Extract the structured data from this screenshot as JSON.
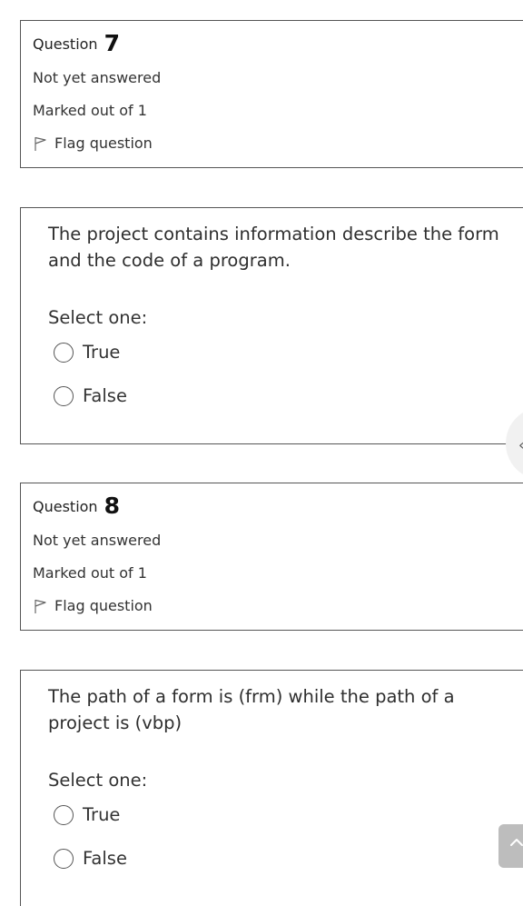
{
  "questions": [
    {
      "label": "Question",
      "number": "7",
      "state": "Not yet answered",
      "grade": "Marked out of 1",
      "flag_label": "Flag question",
      "text": "The project contains information describe the form and the code of a program.",
      "prompt": "Select one:",
      "options": [
        "True",
        "False"
      ]
    },
    {
      "label": "Question",
      "number": "8",
      "state": "Not yet answered",
      "grade": "Marked out of 1",
      "flag_label": "Flag question",
      "text": "The path of a form is (frm) while the path of a project is (vbp)",
      "prompt": "Select one:",
      "options": [
        "True",
        "False"
      ]
    }
  ],
  "icons": {
    "flag": "flag-icon",
    "drawer_toggle": "chevron-left-icon",
    "back_to_top": "chevron-up-icon"
  }
}
